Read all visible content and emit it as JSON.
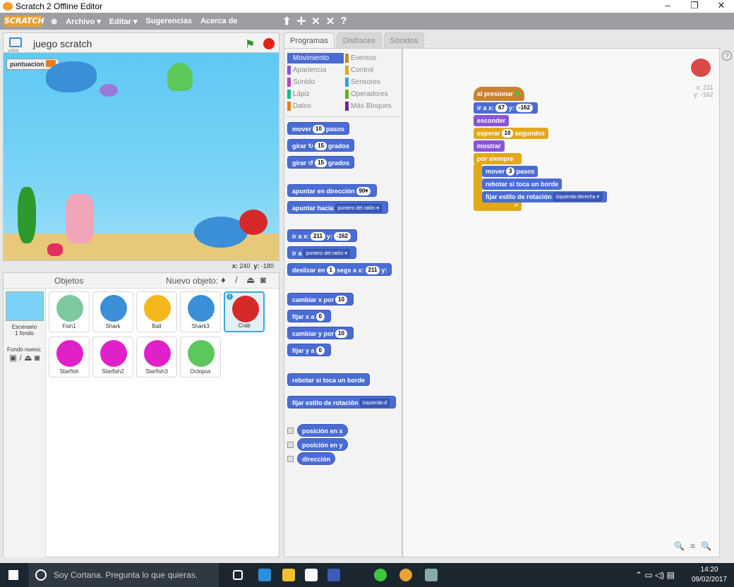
{
  "window": {
    "title": "Scratch 2 Offline Editor",
    "minimize": "–",
    "maximize": "❐",
    "close": "✕"
  },
  "menu": {
    "logo": "SCRATCH",
    "items": [
      "Archivo ▾",
      "Editar ▾",
      "Sugerencias",
      "Acerca de"
    ],
    "tools": [
      "⬆",
      "✛",
      "✕",
      "✕",
      "?"
    ]
  },
  "stage": {
    "project_name": "juego scratch",
    "version": "v454",
    "variable_label": "puntuacion",
    "variable_value": "",
    "mouse_x_label": "x:",
    "mouse_x": "240",
    "mouse_y_label": "y:",
    "mouse_y": "-180"
  },
  "sprites": {
    "header": "Objetos",
    "new_sprite_label": "Nuevo objeto:",
    "stage_label": "Escenario",
    "stage_sub": "1 fondo",
    "new_backdrop": "Fondo nuevo:",
    "list": [
      {
        "name": "Fish1",
        "color": "#7ec8a0"
      },
      {
        "name": "Shark",
        "color": "#3b8fd6"
      },
      {
        "name": "Ball",
        "color": "#f4b81c"
      },
      {
        "name": "Shark3",
        "color": "#3b8fd6"
      },
      {
        "name": "Crab",
        "color": "#d62a2a",
        "selected": true
      },
      {
        "name": "Starfish",
        "color": "#e020c8"
      },
      {
        "name": "Starfish2",
        "color": "#e020c8"
      },
      {
        "name": "Starfish3",
        "color": "#e020c8"
      },
      {
        "name": "Octopus",
        "color": "#5cc85c"
      }
    ]
  },
  "tabs": [
    "Programas",
    "Disfraces",
    "Sonidos"
  ],
  "categories": {
    "left": [
      {
        "label": "Movimiento",
        "color": "#4a6cd4"
      },
      {
        "label": "Apariencia",
        "color": "#8a55d7"
      },
      {
        "label": "Sonido",
        "color": "#bb42c3"
      },
      {
        "label": "Lápiz",
        "color": "#0fbd8c"
      },
      {
        "label": "Datos",
        "color": "#ee7d16"
      }
    ],
    "right": [
      {
        "label": "Eventos",
        "color": "#c88330"
      },
      {
        "label": "Control",
        "color": "#e1a91a"
      },
      {
        "label": "Sensores",
        "color": "#2ca5e2"
      },
      {
        "label": "Operadores",
        "color": "#5cb712"
      },
      {
        "label": "Más Bloques",
        "color": "#632d99"
      }
    ]
  },
  "palette": {
    "mover": "mover",
    "mover_n": "10",
    "mover_s": "pasos",
    "girar": "girar",
    "girar_r": "15",
    "grados": "grados",
    "apuntar_dir": "apuntar en dirección",
    "dir_v": "90▾",
    "apuntar_hacia": "apuntar hacia",
    "puntero": "puntero del ratón ▾",
    "ir_a_x": "ir a x:",
    "x_v": "211",
    "y": "y:",
    "y_v": "-162",
    "ir_a": "ir a",
    "deslizar": "deslizar en",
    "segs": "segs a x:",
    "seg_v": "1",
    "cambiar_x": "cambiar x por",
    "fijar_x": "fijar x a",
    "cambiar_y": "cambiar y por",
    "fijar_y": "fijar y a",
    "ten": "10",
    "zero": "0",
    "rebotar": "rebotar si toca un borde",
    "fijar_estilo": "fijar estilo de rotación",
    "estilo_v": "izquierda-d",
    "pos_x": "posición en x",
    "pos_y": "posición en y",
    "direccion": "dirección"
  },
  "script": {
    "hat": "al presionar",
    "goto": "ir a x:",
    "gx": "67",
    "gy_l": "y:",
    "gy": "-162",
    "hide": "esconder",
    "wait": "esperar",
    "wait_v": "10",
    "wait_u": "segundos",
    "show": "mostrar",
    "forever": "por siempre",
    "move": "mover",
    "move_v": "3",
    "move_u": "pasos",
    "bounce": "rebotar si toca un borde",
    "rotstyle": "fijar estilo de rotación",
    "rot_v": "izquierda-derecha ▾",
    "sprite_x": "x: 211",
    "sprite_y": "y: -162"
  },
  "zoom": {
    "out": "🔍",
    "reset": "=",
    "in": "🔍"
  },
  "taskbar": {
    "cortana": "Soy Cortana. Pregunta lo que quieras.",
    "time": "14:20",
    "date": "09/02/2017"
  }
}
